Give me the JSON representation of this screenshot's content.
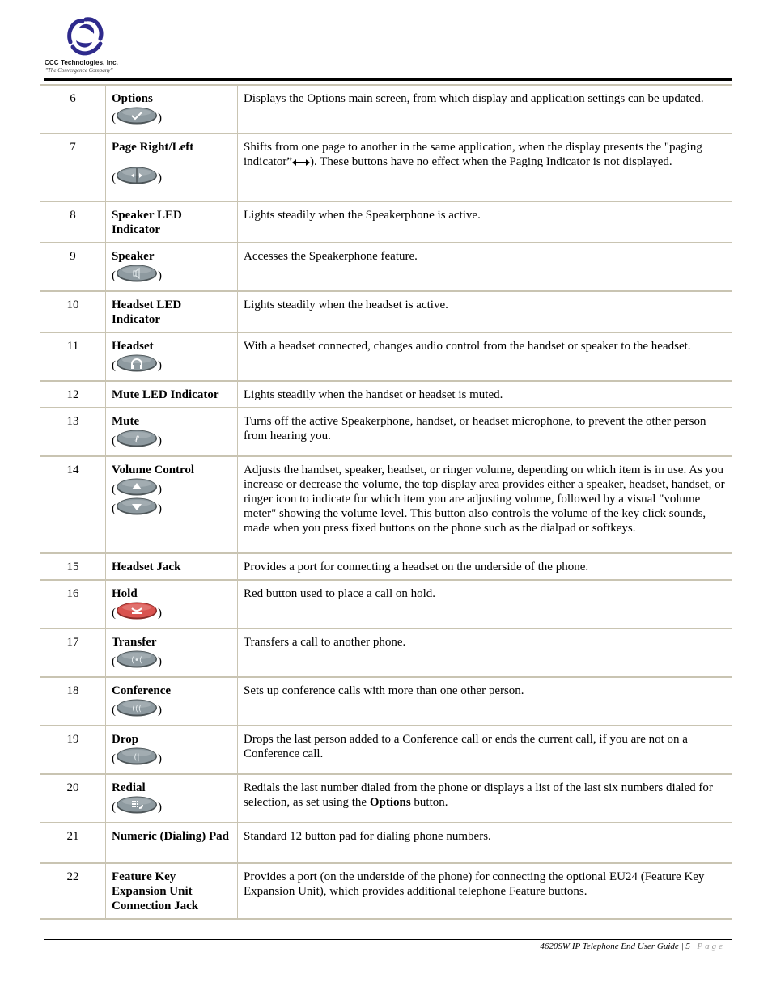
{
  "header": {
    "company_name": "CCC Technologies, Inc.",
    "tagline": "\"The Convergence Company\"",
    "logo_icon": "ccc-swirl-logo",
    "brand_color": "#2e2a8c"
  },
  "table": {
    "rows": [
      {
        "num": "6",
        "name": "Options",
        "keys": [
          "check-icon"
        ],
        "desc": "Displays the Options main screen, from which display and application settings can be updated."
      },
      {
        "num": "7",
        "name": "Page Right/Left",
        "keys": [
          "page-left-right-icon"
        ],
        "desc_parts": [
          "Shifts from one page to another in the same application, when the display presents the \"paging indicator”",
          "). These buttons have no effect when the Paging Indicator is not displayed."
        ],
        "inline_icon": "double-arrow-icon"
      },
      {
        "num": "8",
        "name": "Speaker LED Indicator",
        "keys": [],
        "desc": "Lights steadily when the Speakerphone is active."
      },
      {
        "num": "9",
        "name": "Speaker",
        "keys": [
          "speaker-icon"
        ],
        "desc": "Accesses the Speakerphone feature."
      },
      {
        "num": "10",
        "name": "Headset LED Indicator",
        "keys": [],
        "desc": "Lights steadily when the headset is active."
      },
      {
        "num": "11",
        "name": "Headset",
        "keys": [
          "headset-icon"
        ],
        "desc": "With a headset connected, changes audio control from the handset or speaker to the headset."
      },
      {
        "num": "12",
        "name": "Mute LED Indicator",
        "keys": [],
        "desc": "Lights steadily when the handset or headset is muted."
      },
      {
        "num": "13",
        "name": "Mute",
        "keys": [
          "mute-icon"
        ],
        "desc": "Turns off the active Speakerphone, handset, or headset microphone, to prevent the other person from hearing you."
      },
      {
        "num": "14",
        "name": "Volume Control",
        "keys": [
          "volume-up-icon",
          "volume-down-icon"
        ],
        "desc": "Adjusts the handset, speaker, headset, or ringer volume, depending on which item is in use. As you increase or decrease the volume, the top display area provides either a speaker, headset, handset, or ringer icon to indicate for which item you are adjusting volume, followed by a visual \"volume meter\" showing the volume level. This button also controls the volume of the key click sounds, made when you press fixed buttons on the phone such as the dialpad or softkeys."
      },
      {
        "num": "15",
        "name": "Headset Jack",
        "keys": [],
        "desc": "Provides a port for connecting a headset on the underside of the phone."
      },
      {
        "num": "16",
        "name": "Hold",
        "keys": [
          "hold-icon"
        ],
        "desc": "Red button used to place a call on hold."
      },
      {
        "num": "17",
        "name": "Transfer",
        "keys": [
          "transfer-icon"
        ],
        "desc": "Transfers a call to another phone."
      },
      {
        "num": "18",
        "name": "Conference",
        "keys": [
          "conference-icon"
        ],
        "desc": "Sets up conference calls with more than one other person."
      },
      {
        "num": "19",
        "name": "Drop",
        "keys": [
          "drop-icon"
        ],
        "desc": "Drops the last person added to a Conference call or ends the current call, if you are not on a Conference call."
      },
      {
        "num": "20",
        "name": "Redial",
        "keys": [
          "redial-icon"
        ],
        "desc_parts": [
          "Redials the last number dialed from the phone or displays a list of the last six numbers dialed for selection, as set using the ",
          "Options",
          " button."
        ]
      },
      {
        "num": "21",
        "name": "Numeric (Dialing) Pad",
        "keys": [],
        "desc": "Standard 12 button pad for dialing phone numbers."
      },
      {
        "num": "22",
        "name": "Feature Key Expansion Unit Connection Jack",
        "keys": [],
        "desc": "Provides a port (on the underside of the phone) for connecting the optional EU24 (Feature Key Expansion Unit), which provides additional telephone Feature buttons."
      }
    ],
    "paren_open": "(",
    "paren_close": ")",
    "key_color": "#8e9aa0",
    "hold_key_color": "#d9534f",
    "border_color": "#c9c4b2"
  },
  "footer": {
    "title": "4620SW IP Telephone End User Guide",
    "sep": "|",
    "page_number": "5",
    "page_word": "Page"
  }
}
